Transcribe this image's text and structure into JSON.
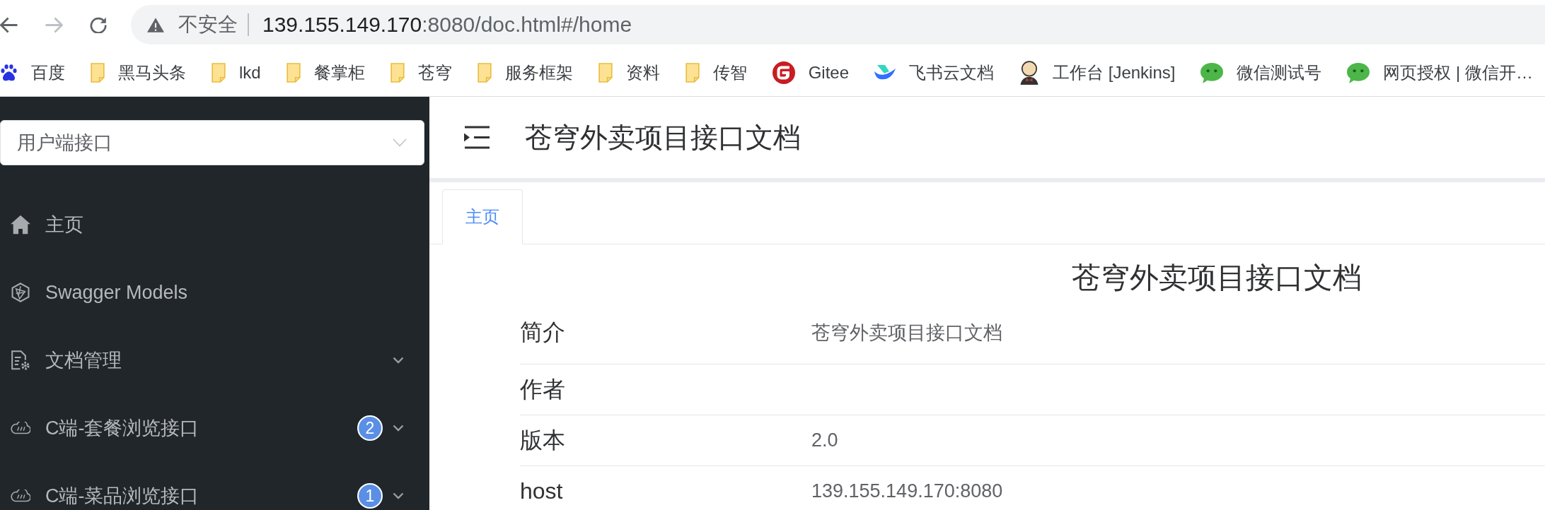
{
  "browser": {
    "nav": [
      {
        "kind": "back",
        "disabled": false
      },
      {
        "kind": "forward",
        "disabled": true
      },
      {
        "kind": "reload",
        "disabled": false
      }
    ],
    "security_label": "不安全",
    "url_host": "139.155.149.170",
    "url_rest": ":8080/doc.html#/home"
  },
  "bookmarks": [
    {
      "kind": "paw",
      "label": "百度"
    },
    {
      "kind": "folder",
      "label": "黑马头条"
    },
    {
      "kind": "folder",
      "label": "lkd"
    },
    {
      "kind": "folder",
      "label": "餐掌柜"
    },
    {
      "kind": "folder",
      "label": "苍穹"
    },
    {
      "kind": "folder",
      "label": "服务框架"
    },
    {
      "kind": "folder",
      "label": "资料"
    },
    {
      "kind": "folder",
      "label": "传智"
    },
    {
      "kind": "ring",
      "label": "Gitee"
    },
    {
      "kind": "wing",
      "label": "飞书云文档"
    },
    {
      "kind": "person",
      "label": "工作台 [Jenkins]"
    },
    {
      "kind": "chat",
      "label": "微信测试号"
    },
    {
      "kind": "chat",
      "label": "网页授权 | 微信开…"
    }
  ],
  "sidebar": {
    "group_select": {
      "value": "用户端接口"
    },
    "items": [
      {
        "kind": "home",
        "label": "主页"
      },
      {
        "kind": "models",
        "label": "Swagger Models"
      },
      {
        "kind": "manage",
        "label": "文档管理",
        "expanded": false
      },
      {
        "kind": "api",
        "label": "C端-套餐浏览接口",
        "badge": "2",
        "expanded": false
      },
      {
        "kind": "api",
        "label": "C端-菜品浏览接口",
        "badge": "1",
        "expanded": false
      }
    ]
  },
  "header": {
    "title": "苍穹外卖项目接口文档"
  },
  "tabs": [
    {
      "label": "主页",
      "selected": true
    }
  ],
  "content": {
    "title": "苍穹外卖项目接口文档",
    "rows": [
      {
        "label": "简介",
        "value": "苍穹外卖项目接口文档"
      },
      {
        "label": "作者"
      },
      {
        "label": "版本",
        "value": "2.0"
      },
      {
        "label": "host",
        "value": "139.155.149.170:8080"
      }
    ]
  }
}
